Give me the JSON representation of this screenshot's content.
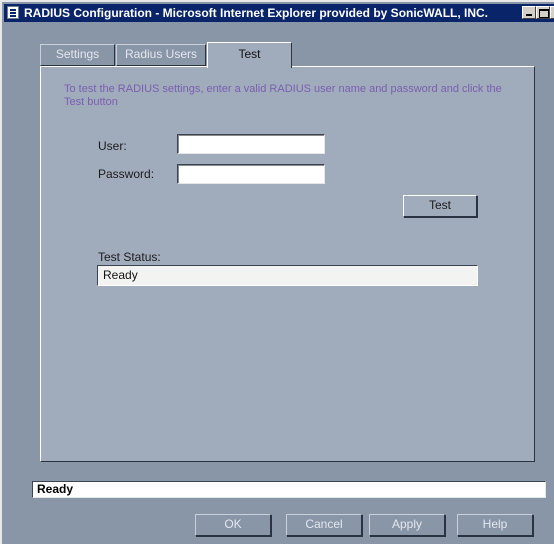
{
  "window": {
    "title": "RADIUS Configuration - Microsoft Internet Explorer provided by SonicWALL, INC."
  },
  "tabs": [
    {
      "label": "Settings",
      "active": false
    },
    {
      "label": "Radius Users",
      "active": false
    },
    {
      "label": "Test",
      "active": true
    }
  ],
  "test_panel": {
    "instructions": "To test the RADIUS settings, enter a valid RADIUS user name and password and click the Test button",
    "user_label": "User:",
    "user_value": "",
    "password_label": "Password:",
    "password_value": "",
    "test_button": "Test",
    "status_label": "Test Status:",
    "status_value": "Ready"
  },
  "statusbar": {
    "text": "Ready"
  },
  "buttons": {
    "ok": "OK",
    "cancel": "Cancel",
    "apply": "Apply",
    "help": "Help"
  },
  "colors": {
    "dialog_bg": "#8896a8",
    "panel_bg": "#a0abbc",
    "titlebar": "#0a246a",
    "instructions_text": "#7a5fb0"
  },
  "icons": {
    "app": "ie-window-icon",
    "minimize": "minimize-icon",
    "maximize": "maximize-icon",
    "close": "close-icon"
  }
}
